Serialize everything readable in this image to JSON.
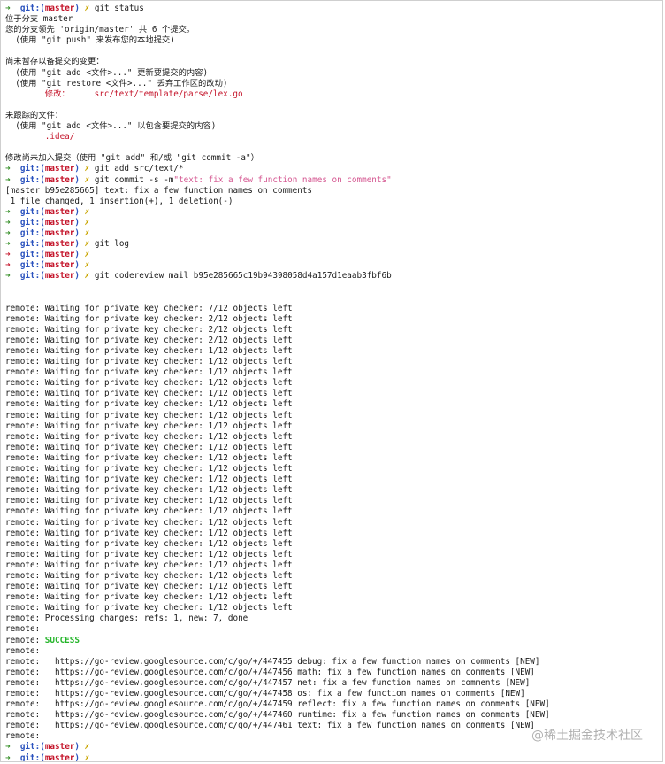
{
  "colors": {
    "arrow_green": "#2e8b1f",
    "arrow_red": "#c4142a",
    "git_blue": "#2a52be",
    "branch_red": "#c4142a",
    "dirty_yellow": "#c9a500",
    "success_green": "#25b52a",
    "commit_msg_pink": "#d4548f"
  },
  "prompt": {
    "arrow": "➜",
    "git": "git:",
    "open": "(",
    "branch": "master",
    "close": ")",
    "dirty": "✗"
  },
  "lines": [
    {
      "t": "prompt",
      "arrow": "g",
      "cmd": "git status"
    },
    {
      "t": "plain",
      "text": "位于分支 master"
    },
    {
      "t": "plain",
      "text": "您的分支领先 'origin/master' 共 6 个提交。"
    },
    {
      "t": "plain",
      "text": "  (使用 \"git push\" 来发布您的本地提交)"
    },
    {
      "t": "blank"
    },
    {
      "t": "plain",
      "text": "尚未暂存以备提交的变更："
    },
    {
      "t": "plain",
      "text": "  (使用 \"git add <文件>...\" 更新要提交的内容)"
    },
    {
      "t": "plain",
      "text": "  (使用 \"git restore <文件>...\" 丢弃工作区的改动)"
    },
    {
      "t": "red",
      "text": "        修改：     src/text/template/parse/lex.go"
    },
    {
      "t": "blank"
    },
    {
      "t": "plain",
      "text": "未跟踪的文件："
    },
    {
      "t": "plain",
      "text": "  (使用 \"git add <文件>...\" 以包含要提交的内容)"
    },
    {
      "t": "red",
      "text": "        .idea/"
    },
    {
      "t": "blank"
    },
    {
      "t": "plain",
      "text": "修改尚未加入提交（使用 \"git add\" 和/或 \"git commit -a\"）"
    },
    {
      "t": "prompt",
      "arrow": "g",
      "cmd": "git add src/text/*"
    },
    {
      "t": "prompt",
      "arrow": "g",
      "cmd": "git commit -s -m",
      "msg": "\"text: fix a few function names on comments\""
    },
    {
      "t": "plain",
      "text": "[master b95e285665] text: fix a few function names on comments"
    },
    {
      "t": "plain",
      "text": " 1 file changed, 1 insertion(+), 1 deletion(-)"
    },
    {
      "t": "prompt",
      "arrow": "g",
      "cmd": ""
    },
    {
      "t": "prompt",
      "arrow": "g",
      "cmd": ""
    },
    {
      "t": "prompt",
      "arrow": "g",
      "cmd": ""
    },
    {
      "t": "prompt",
      "arrow": "g",
      "cmd": "git log",
      "mark": true
    },
    {
      "t": "prompt",
      "arrow": "r",
      "cmd": ""
    },
    {
      "t": "prompt",
      "arrow": "r",
      "cmd": ""
    },
    {
      "t": "prompt",
      "arrow": "g",
      "cmd": "git codereview mail b95e285665c19b94398058d4a157d1eaab3fbf6b"
    },
    {
      "t": "blank",
      "mark": true
    },
    {
      "t": "blank"
    },
    {
      "t": "plain",
      "text": "remote: Waiting for private key checker: 7/12 objects left",
      "mark": true
    },
    {
      "t": "plain",
      "text": "remote: Waiting for private key checker: 2/12 objects left"
    },
    {
      "t": "plain",
      "text": "remote: Waiting for private key checker: 2/12 objects left",
      "mark": true
    },
    {
      "t": "plain",
      "text": "remote: Waiting for private key checker: 2/12 objects left"
    },
    {
      "t": "plain",
      "text": "remote: Waiting for private key checker: 1/12 objects left"
    },
    {
      "t": "plain",
      "text": "remote: Waiting for private key checker: 1/12 objects left"
    },
    {
      "t": "plain",
      "text": "remote: Waiting for private key checker: 1/12 objects left"
    },
    {
      "t": "plain",
      "text": "remote: Waiting for private key checker: 1/12 objects left"
    },
    {
      "t": "plain",
      "text": "remote: Waiting for private key checker: 1/12 objects left"
    },
    {
      "t": "plain",
      "text": "remote: Waiting for private key checker: 1/12 objects left"
    },
    {
      "t": "plain",
      "text": "remote: Waiting for private key checker: 1/12 objects left"
    },
    {
      "t": "plain",
      "text": "remote: Waiting for private key checker: 1/12 objects left"
    },
    {
      "t": "plain",
      "text": "remote: Waiting for private key checker: 1/12 objects left"
    },
    {
      "t": "plain",
      "text": "remote: Waiting for private key checker: 1/12 objects left"
    },
    {
      "t": "plain",
      "text": "remote: Waiting for private key checker: 1/12 objects left"
    },
    {
      "t": "plain",
      "text": "remote: Waiting for private key checker: 1/12 objects left"
    },
    {
      "t": "plain",
      "text": "remote: Waiting for private key checker: 1/12 objects left"
    },
    {
      "t": "plain",
      "text": "remote: Waiting for private key checker: 1/12 objects left"
    },
    {
      "t": "plain",
      "text": "remote: Waiting for private key checker: 1/12 objects left"
    },
    {
      "t": "plain",
      "text": "remote: Waiting for private key checker: 1/12 objects left"
    },
    {
      "t": "plain",
      "text": "remote: Waiting for private key checker: 1/12 objects left"
    },
    {
      "t": "plain",
      "text": "remote: Waiting for private key checker: 1/12 objects left"
    },
    {
      "t": "plain",
      "text": "remote: Waiting for private key checker: 1/12 objects left"
    },
    {
      "t": "plain",
      "text": "remote: Waiting for private key checker: 1/12 objects left"
    },
    {
      "t": "plain",
      "text": "remote: Waiting for private key checker: 1/12 objects left"
    },
    {
      "t": "plain",
      "text": "remote: Waiting for private key checker: 1/12 objects left"
    },
    {
      "t": "plain",
      "text": "remote: Waiting for private key checker: 1/12 objects left"
    },
    {
      "t": "plain",
      "text": "remote: Waiting for private key checker: 1/12 objects left"
    },
    {
      "t": "plain",
      "text": "remote: Waiting for private key checker: 1/12 objects left"
    },
    {
      "t": "plain",
      "text": "remote: Processing changes: refs: 1, new: 7, done"
    },
    {
      "t": "plain",
      "text": "remote:"
    },
    {
      "t": "success",
      "prefix": "remote: ",
      "text": "SUCCESS"
    },
    {
      "t": "plain",
      "text": "remote:"
    },
    {
      "t": "plain",
      "text": "remote:   https://go-review.googlesource.com/c/go/+/447455 debug: fix a few function names on comments [NEW]"
    },
    {
      "t": "plain",
      "text": "remote:   https://go-review.googlesource.com/c/go/+/447456 math: fix a few function names on comments [NEW]"
    },
    {
      "t": "plain",
      "text": "remote:   https://go-review.googlesource.com/c/go/+/447457 net: fix a few function names on comments [NEW]"
    },
    {
      "t": "plain",
      "text": "remote:   https://go-review.googlesource.com/c/go/+/447458 os: fix a few function names on comments [NEW]"
    },
    {
      "t": "plain",
      "text": "remote:   https://go-review.googlesource.com/c/go/+/447459 reflect: fix a few function names on comments [NEW]"
    },
    {
      "t": "plain",
      "text": "remote:   https://go-review.googlesource.com/c/go/+/447460 runtime: fix a few function names on comments [NEW]"
    },
    {
      "t": "plain",
      "text": "remote:   https://go-review.googlesource.com/c/go/+/447461 text: fix a few function names on comments [NEW]"
    },
    {
      "t": "plain",
      "text": "remote:"
    },
    {
      "t": "prompt",
      "arrow": "g",
      "cmd": ""
    },
    {
      "t": "prompt",
      "arrow": "g",
      "cmd": ""
    }
  ],
  "watermark": "@稀土掘金技术社区"
}
